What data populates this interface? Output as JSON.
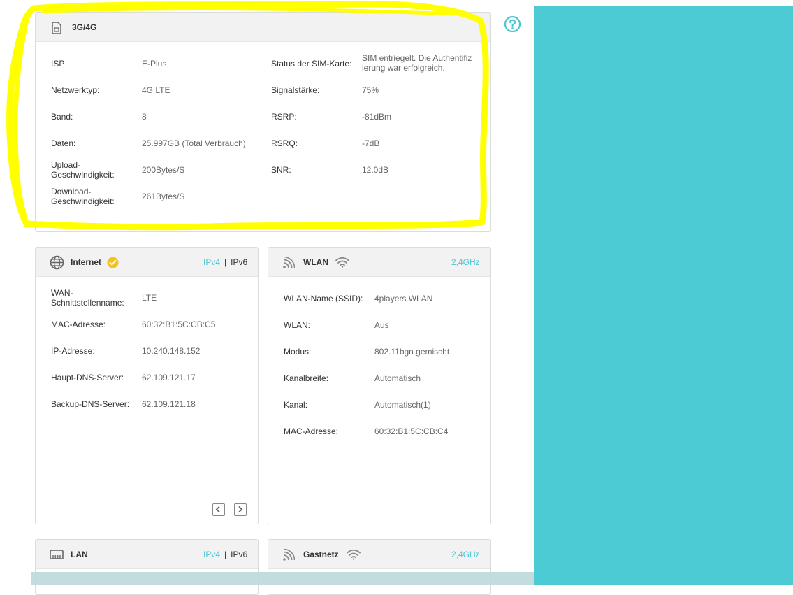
{
  "colors": {
    "accent": "#4cc5d4",
    "panel": "#4ccbd5",
    "highlight": "#ffff00",
    "check": "#f5c21b"
  },
  "sim_card": {
    "title": "3G/4G",
    "icon": "sim-card-icon",
    "left_rows": [
      {
        "label": "ISP",
        "value": "E-Plus"
      },
      {
        "label": "Netzwerktyp:",
        "value": "4G LTE"
      },
      {
        "label": "Band:",
        "value": "8"
      },
      {
        "label": "Daten:",
        "value": "25.997GB (Total Verbrauch)"
      },
      {
        "label": "Upload-Geschwindigkeit:",
        "value": "200Bytes/S"
      },
      {
        "label": "Download-Geschwindigkeit:",
        "value": "261Bytes/S"
      }
    ],
    "right_rows": [
      {
        "label": "Status der SIM-Karte:",
        "value": "SIM entriegelt. Die Authentifizierung war erfolgreich."
      },
      {
        "label": "Signalstärke:",
        "value": "75%"
      },
      {
        "label": "RSRP:",
        "value": "-81dBm"
      },
      {
        "label": "RSRQ:",
        "value": "-7dB"
      },
      {
        "label": "SNR:",
        "value": "12.0dB"
      }
    ]
  },
  "internet_card": {
    "title": "Internet",
    "icon": "globe-icon",
    "status_icon": "check-circle-icon",
    "tab_ipv4": "IPv4",
    "tab_sep": "|",
    "tab_ipv6": "IPv6",
    "rows": [
      {
        "label": "WAN-Schnittstellenname:",
        "value": "LTE"
      },
      {
        "label": "MAC-Adresse:",
        "value": "60:32:B1:5C:CB:C5"
      },
      {
        "label": "IP-Adresse:",
        "value": "10.240.148.152"
      },
      {
        "label": "Haupt-DNS-Server:",
        "value": "62.109.121.17"
      },
      {
        "label": "Backup-DNS-Server:",
        "value": "62.109.121.18"
      }
    ],
    "nav_prev_icon": "chevron-left-icon",
    "nav_next_icon": "chevron-right-icon"
  },
  "wlan_card": {
    "title": "WLAN",
    "icon": "wireless-icon",
    "status_icon": "wifi-icon",
    "band": "2,4GHz",
    "rows": [
      {
        "label": "WLAN-Name (SSID):",
        "value": "4players WLAN"
      },
      {
        "label": "WLAN:",
        "value": "Aus"
      },
      {
        "label": "Modus:",
        "value": "802.11bgn gemischt"
      },
      {
        "label": "Kanalbreite:",
        "value": "Automatisch"
      },
      {
        "label": "Kanal:",
        "value": "Automatisch(1)"
      },
      {
        "label": "MAC-Adresse:",
        "value": "60:32:B1:5C:CB:C4"
      }
    ]
  },
  "lan_card": {
    "title": "LAN",
    "icon": "lan-port-icon",
    "tab_ipv4": "IPv4",
    "tab_sep": "|",
    "tab_ipv6": "IPv6"
  },
  "guest_card": {
    "title": "Gastnetz",
    "icon": "wireless-icon",
    "status_icon": "wifi-icon",
    "band": "2,4GHz"
  },
  "help_icon": "help-icon"
}
